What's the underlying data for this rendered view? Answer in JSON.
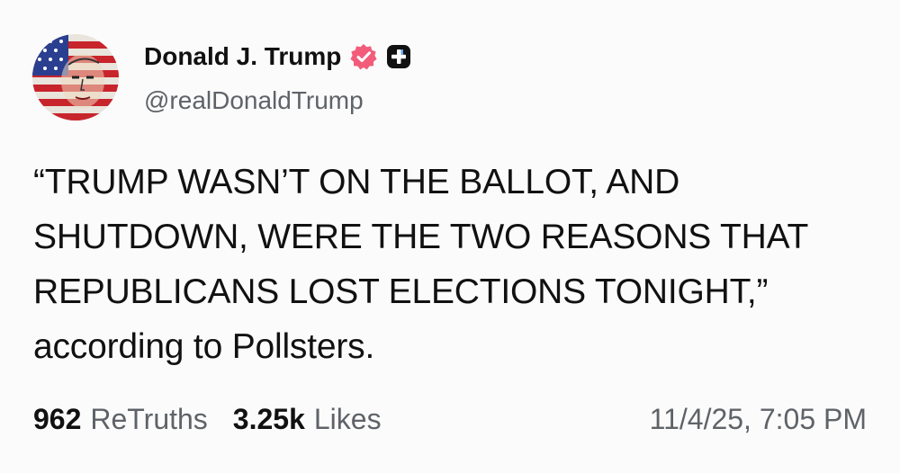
{
  "author": {
    "display_name": "Donald J. Trump",
    "handle": "@realDonaldTrump",
    "avatar_icon": "flag-portrait-avatar",
    "verified_icon": "verified-badge-icon",
    "plus_icon": "truth-plus-icon",
    "verified_color": "#f25c7a"
  },
  "post": {
    "lines": [
      "“TRUMP WASN’T ON THE BALLOT, AND",
      "SHUTDOWN, WERE THE TWO REASONS THAT",
      "REPUBLICANS LOST ELECTIONS TONIGHT,”",
      "according to Pollsters."
    ]
  },
  "stats": {
    "retruths_count": "962",
    "retruths_label": "ReTruths",
    "likes_count": "3.25k",
    "likes_label": "Likes"
  },
  "timestamp": "11/4/25, 7:05 PM"
}
